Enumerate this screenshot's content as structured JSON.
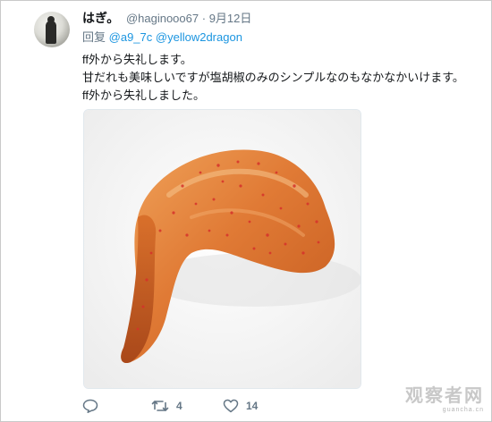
{
  "tweet": {
    "display_name": "はぎ。",
    "handle": "@haginooo67",
    "separator": "·",
    "date": "9月12日",
    "reply_prefix": "回复",
    "reply_to": [
      "@a9_7c",
      "@yellow2dragon"
    ],
    "lines": [
      "ff外から失礼します。",
      "甘だれも美味しいですが塩胡椒のみのシンプルなのもなかなかいけます。",
      "ff外から失礼しました。"
    ],
    "actions": {
      "reply_icon": "reply-icon",
      "retweet_icon": "retweet-icon",
      "retweet_count": "4",
      "like_icon": "heart-icon",
      "like_count": "14"
    }
  },
  "watermark": {
    "main": "观察者网",
    "sub": "guancha.cn"
  },
  "colors": {
    "name": "#14171a",
    "meta": "#657786",
    "link": "#1b95e0",
    "border": "#e1e8ed"
  }
}
